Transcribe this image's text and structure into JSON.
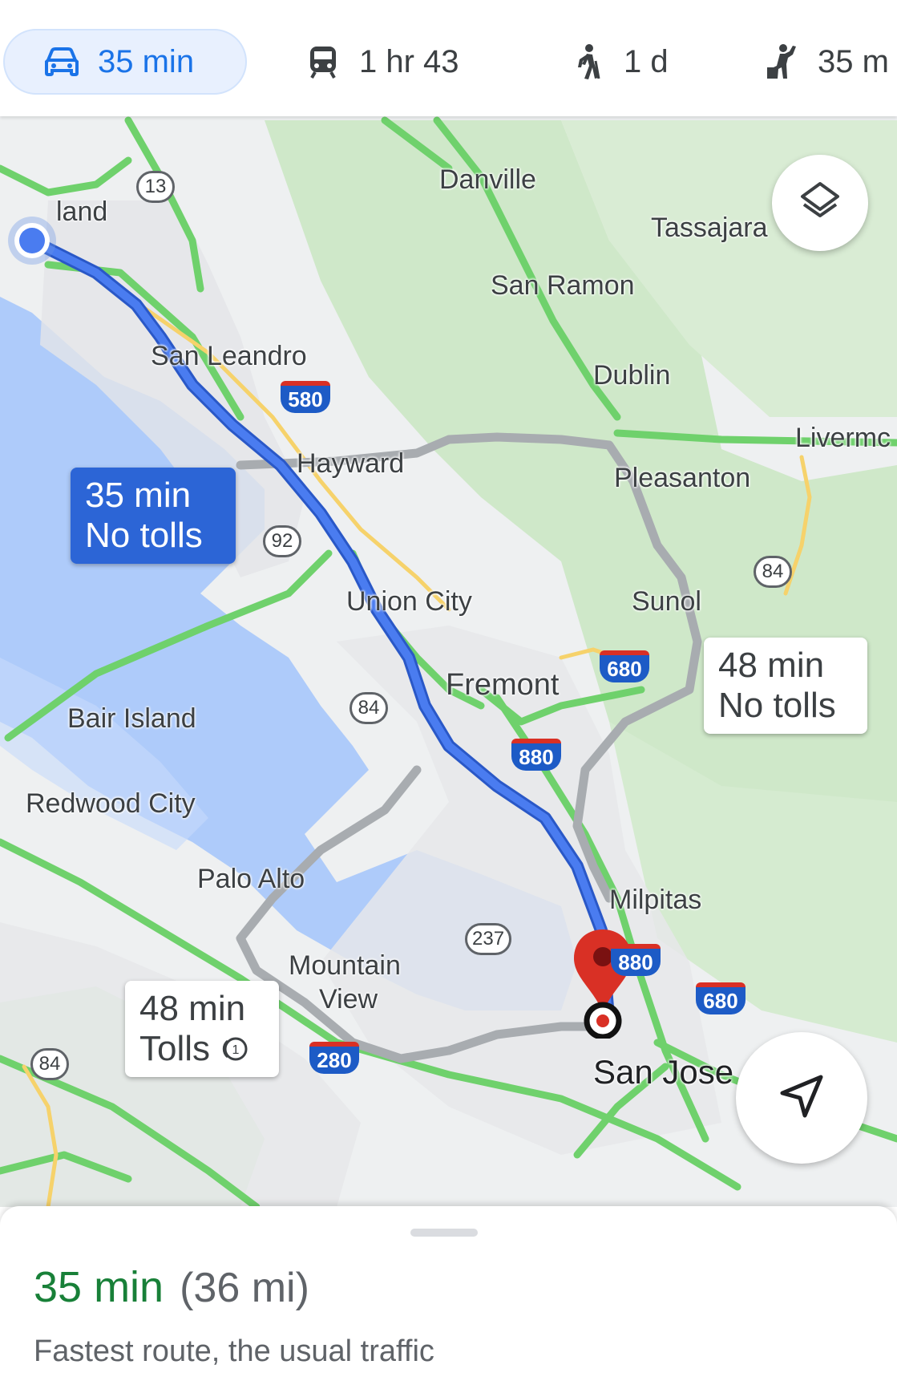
{
  "modes": [
    {
      "name": "drive",
      "label": "35 min",
      "icon": "car-icon",
      "active": true
    },
    {
      "name": "transit",
      "label": "1 hr 43",
      "icon": "train-icon",
      "active": false
    },
    {
      "name": "walk",
      "label": "1 d",
      "icon": "walk-icon",
      "active": false
    },
    {
      "name": "ride",
      "label": "35 m",
      "icon": "rideshare-icon",
      "active": false
    }
  ],
  "places": {
    "oakland": "land",
    "danville": "Danville",
    "tassajara": "Tassajara",
    "san_ramon": "San Ramon",
    "san_leandro": "San Leandro",
    "dublin": "Dublin",
    "livermore": "Livermc",
    "hayward": "Hayward",
    "pleasanton": "Pleasanton",
    "union_city": "Union City",
    "sunol": "Sunol",
    "fremont": "Fremont",
    "bair_island": "Bair Island",
    "redwood_city": "Redwood City",
    "palo_alto": "Palo Alto",
    "milpitas": "Milpitas",
    "mountain_view_1": "Mountain",
    "mountain_view_2": "View",
    "san_jose": "San Jose"
  },
  "highways": {
    "ca13": "13",
    "i580": "580",
    "ca92": "92",
    "ca84_east": "84",
    "i680_north": "680",
    "ca84_mid": "84",
    "i880_mid": "880",
    "ca237": "237",
    "i880_south": "880",
    "i680_south": "680",
    "i280": "280",
    "ca84_west": "84"
  },
  "routes": {
    "primary": {
      "line1": "35 min",
      "line2": "No tolls"
    },
    "alt_east": {
      "line1": "48 min",
      "line2": "No tolls"
    },
    "alt_west": {
      "line1": "48 min",
      "line2": "Tolls"
    }
  },
  "colors": {
    "primary_route": "#4a7cf0",
    "alt_route": "#a8acb0",
    "traffic_green": "#6fd16c",
    "water": "#aecbfa",
    "destination_pin": "#d93025"
  },
  "summary": {
    "time": "35 min",
    "distance": "(36 mi)",
    "description": "Fastest route, the usual traffic"
  }
}
